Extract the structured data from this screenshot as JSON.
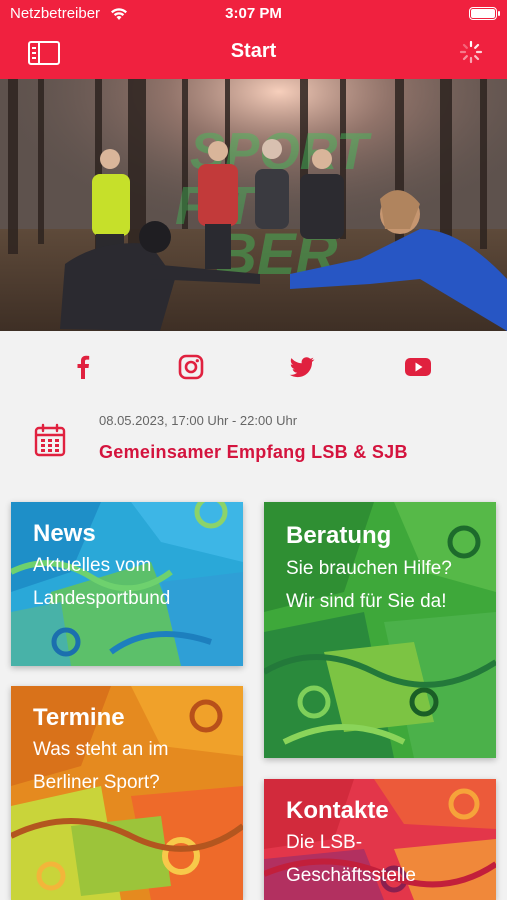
{
  "status_bar": {
    "carrier": "Netzbetreiber",
    "time": "3:07 PM"
  },
  "nav": {
    "title": "Start",
    "left_icon": "sidebar-icon",
    "right_icon": "spinner-icon"
  },
  "hero": {
    "image": "group-outdoor-workout-photo"
  },
  "social": [
    {
      "name": "facebook",
      "glyph": "f"
    },
    {
      "name": "instagram"
    },
    {
      "name": "twitter"
    },
    {
      "name": "youtube"
    }
  ],
  "event": {
    "date": "08.05.2023, 17:00 Uhr - 22:00 Uhr",
    "title": "Gemeinsamer Empfang LSB & SJB"
  },
  "tiles": {
    "news": {
      "title": "News",
      "line1": "Aktuelles vom",
      "line2": "Landesportbund"
    },
    "beratung": {
      "title": "Beratung",
      "line1": "Sie brauchen Hilfe?",
      "line2": "Wir sind für Sie da!"
    },
    "termine": {
      "title": "Termine",
      "line1": "Was steht an im",
      "line2": "Berliner Sport?"
    },
    "kontakte": {
      "title": "Kontakte",
      "line1": "Die LSB-",
      "line2": "Geschäftsstelle"
    }
  },
  "colors": {
    "brand_red": "#f0213f",
    "event_red": "#d4143e",
    "background": "#f2f2f2"
  }
}
